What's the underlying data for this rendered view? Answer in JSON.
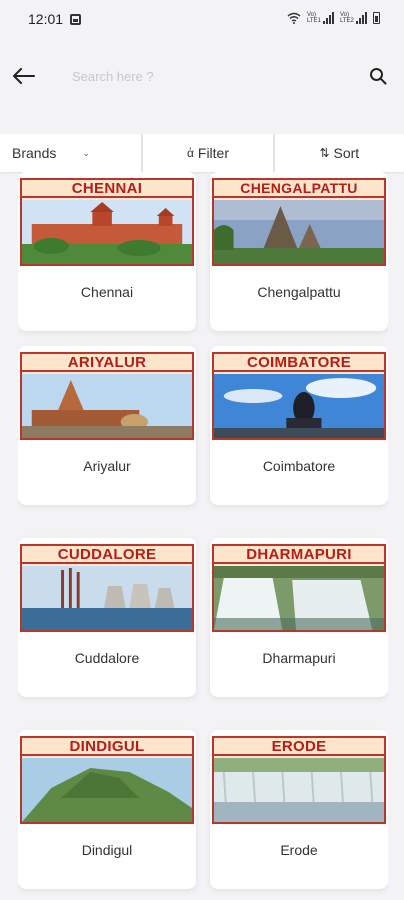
{
  "status_bar": {
    "time": "12:01",
    "signal_label_1": "Vo) LTE1",
    "signal_label_2": "Vo) LTE2",
    "icons": [
      "gallery-icon",
      "wifi-icon",
      "signal-icon",
      "battery-icon"
    ]
  },
  "header": {
    "search_placeholder": "Search here ?",
    "back_icon": "arrow-left-icon",
    "search_icon": "magnifier-icon"
  },
  "filter_bar": {
    "brands_label": "Brands",
    "filter_label": "Filter",
    "sort_label": "Sort"
  },
  "districts": [
    {
      "banner": "CHENNAI",
      "name": "Chennai",
      "sky": "#cfe3f4",
      "scene": "temple-building"
    },
    {
      "banner": "CHENGALPATTU",
      "name": "Chengalpattu",
      "sky": "#8aa3c4",
      "scene": "shore-temple"
    },
    {
      "banner": "ARIYALUR",
      "name": "Ariyalur",
      "sky": "#bcd8f0",
      "scene": "temple-tower"
    },
    {
      "banner": "COIMBATORE",
      "name": "Coimbatore",
      "sky": "#3f86d6",
      "scene": "adiyogi-statue"
    },
    {
      "banner": "CUDDALORE",
      "name": "Cuddalore",
      "sky": "#c9dcec",
      "scene": "power-plant"
    },
    {
      "banner": "DHARMAPURI",
      "name": "Dharmapuri",
      "sky": "#7d9a6a",
      "scene": "waterfall"
    },
    {
      "banner": "DINDIGUL",
      "name": "Dindigul",
      "sky": "#a9cde4",
      "scene": "rock-hill"
    },
    {
      "banner": "ERODE",
      "name": "Erode",
      "sky": "#8fb07c",
      "scene": "river-falls"
    }
  ]
}
